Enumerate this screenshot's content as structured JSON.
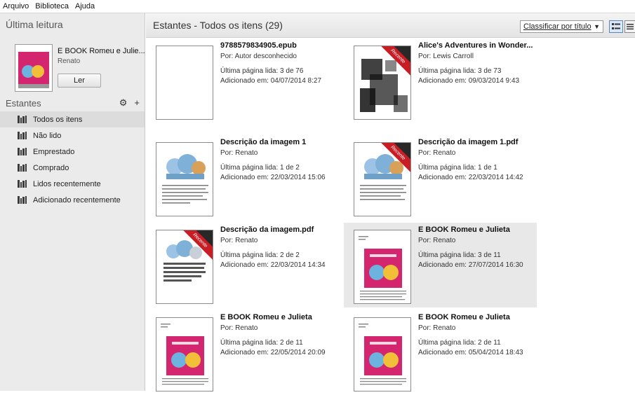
{
  "menu": {
    "items": [
      "Arquivo",
      "Biblioteca",
      "Ajuda"
    ]
  },
  "sidebar": {
    "last_read_heading": "Última leitura",
    "last_read": {
      "title": "E BOOK Romeu e Julie...",
      "author": "Renato",
      "read_button": "Ler"
    },
    "shelves_heading": "Estantes",
    "shelf_tools": {
      "gear": "⚙",
      "add": "+"
    },
    "shelves": [
      {
        "label": "Todos os itens",
        "active": true
      },
      {
        "label": "Não lido"
      },
      {
        "label": "Emprestado"
      },
      {
        "label": "Comprado"
      },
      {
        "label": "Lidos recentemente"
      },
      {
        "label": "Adicionado recentemente"
      }
    ]
  },
  "main": {
    "title": "Estantes - Todos os itens (29)",
    "sort": {
      "selected": "Classificar por título"
    }
  },
  "books": [
    {
      "title": "9788579834905.epub",
      "author": "Por:  Autor desconhecido",
      "page": "Última página lida:  3 de 76",
      "added": "Adicionado em:  04/07/2014 8:27",
      "cover": "blank"
    },
    {
      "title": "Alice's Adventures in Wonder...",
      "author": "Por:  Lewis Carroll",
      "page": "Última página lida:  3 de 73",
      "added": "Adicionado em:  09/03/2014 9:43",
      "cover": "alice",
      "ribbon": "Recente"
    },
    {
      "title": "Descrição da imagem 1",
      "author": "Por:  Renato",
      "page": "Última página lida:  1 de 2",
      "added": "Adicionado em:  22/03/2014 15:06",
      "cover": "drawing"
    },
    {
      "title": "Descrição da imagem 1.pdf",
      "author": "Por:  Renato",
      "page": "Última página lida:  1 de 1",
      "added": "Adicionado em:  22/03/2014 14:42",
      "cover": "drawing",
      "ribbon": "Recente"
    },
    {
      "title": "Descrição da imagem.pdf",
      "author": "Por:  Renato",
      "page": "Última página lida:  2 de 2",
      "added": "Adicionado em:  22/03/2014 14:34",
      "cover": "drawing-lines",
      "ribbon": "Recente"
    },
    {
      "title": "E BOOK Romeu e Julieta",
      "author": "Por:  Renato",
      "page": "Última página lida:  3 de 11",
      "added": "Adicionado em:  27/07/2014 16:30",
      "cover": "romeu",
      "selected": true
    },
    {
      "title": "E BOOK Romeu e Julieta",
      "author": "Por:  Renato",
      "page": "Última página lida:  2 de 11",
      "added": "Adicionado em:  22/05/2014 20:09",
      "cover": "romeu"
    },
    {
      "title": "E BOOK Romeu e Julieta",
      "author": "Por:  Renato",
      "page": "Última página lida:  2 de 11",
      "added": "Adicionado em:  05/04/2014 18:43",
      "cover": "romeu"
    }
  ],
  "colors": {
    "ribbon": "#c81d25",
    "cover_pink": "#d4266e",
    "sidebar_bg": "#ebebeb",
    "selected_bg": "#e8e8e8"
  }
}
